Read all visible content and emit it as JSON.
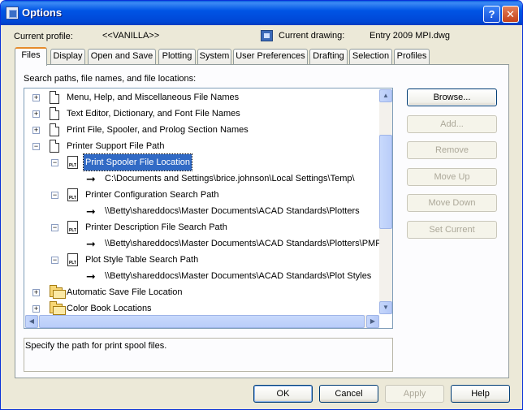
{
  "window": {
    "title": "Options",
    "help_btn": "?",
    "close_btn": "✕"
  },
  "profile": {
    "label": "Current profile:",
    "value": "<<VANILLA>>"
  },
  "drawing": {
    "label": "Current drawing:",
    "value": "Entry 2009 MPI.dwg"
  },
  "tabs": [
    {
      "label": "Files"
    },
    {
      "label": "Display"
    },
    {
      "label": "Open and Save"
    },
    {
      "label": "Plotting"
    },
    {
      "label": "System"
    },
    {
      "label": "User Preferences"
    },
    {
      "label": "Drafting"
    },
    {
      "label": "Selection"
    },
    {
      "label": "Profiles"
    }
  ],
  "search_label": "Search paths, file names, and file locations:",
  "tree": [
    {
      "text": "Menu, Help, and Miscellaneous File Names",
      "expander": "+"
    },
    {
      "text": "Text Editor, Dictionary, and Font File Names",
      "expander": "+"
    },
    {
      "text": "Print File, Spooler, and Prolog Section Names",
      "expander": "+"
    },
    {
      "text": "Printer Support File Path",
      "expander": "−"
    },
    {
      "text": "Print Spooler File Location",
      "expander": "−"
    },
    {
      "text": "C:\\Documents and Settings\\brice.johnson\\Local Settings\\Temp\\"
    },
    {
      "text": "Printer Configuration Search Path",
      "expander": "−"
    },
    {
      "text": "\\\\Betty\\shareddocs\\Master Documents\\ACAD Standards\\Plotters"
    },
    {
      "text": "Printer Description File Search Path",
      "expander": "−"
    },
    {
      "text": "\\\\Betty\\shareddocs\\Master Documents\\ACAD Standards\\Plotters\\PMP"
    },
    {
      "text": "Plot Style Table Search Path",
      "expander": "−"
    },
    {
      "text": "\\\\Betty\\shareddocs\\Master Documents\\ACAD Standards\\Plot Styles"
    },
    {
      "text": "Automatic Save File Location",
      "expander": "+"
    },
    {
      "text": "Color Book Locations",
      "expander": "+"
    }
  ],
  "icons": {
    "plt_label": "PLT",
    "arrow": "➞",
    "up": "▲",
    "down": "▼",
    "left": "◀",
    "right": "▶"
  },
  "description": "Specify the path for print spool files.",
  "side_buttons": {
    "browse": "Browse...",
    "add": "Add...",
    "remove": "Remove",
    "move_up": "Move Up",
    "move_down": "Move Down",
    "set_current": "Set Current"
  },
  "bottom_buttons": {
    "ok": "OK",
    "cancel": "Cancel",
    "apply": "Apply",
    "help": "Help"
  },
  "colors": {
    "title_bar": "#0055e5",
    "selection": "#316ac5",
    "dialog": "#ece9d8"
  }
}
